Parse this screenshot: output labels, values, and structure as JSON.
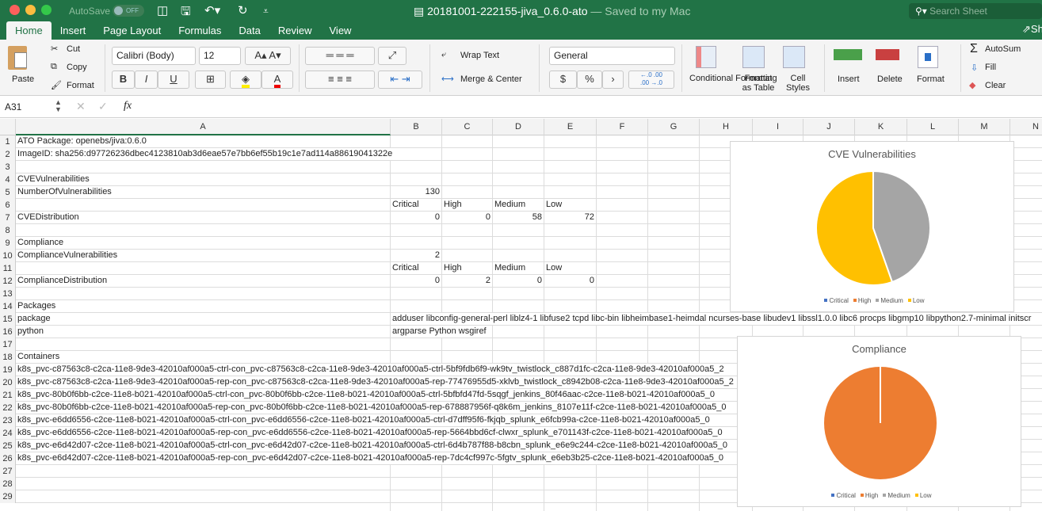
{
  "window": {
    "autosave": "AutoSave",
    "toggle": "OFF",
    "file_name": "20181001-222155-jiva_0.6.0-ato",
    "saved_status": " — Saved to my Mac",
    "search_placeholder": "Search Sheet",
    "share": "Sh"
  },
  "tabs": [
    {
      "label": "Home",
      "active": true
    },
    {
      "label": "Insert"
    },
    {
      "label": "Page Layout"
    },
    {
      "label": "Formulas"
    },
    {
      "label": "Data"
    },
    {
      "label": "Review"
    },
    {
      "label": "View"
    }
  ],
  "ribbon": {
    "paste": "Paste",
    "cut": "Cut",
    "copy": "Copy",
    "format_painter": "Format",
    "font_name": "Calibri (Body)",
    "font_size": "12",
    "bold": "B",
    "italic": "I",
    "underline": "U",
    "wrap_text": "Wrap Text",
    "merge_center": "Merge & Center",
    "number_format": "General",
    "currency": "$",
    "percent": "%",
    "comma": "›",
    "conditional_formatting": "Conditional Formatting",
    "format_as_table": "Format as Table",
    "cell_styles": "Cell Styles",
    "insert": "Insert",
    "delete": "Delete",
    "format": "Format",
    "autosum": "AutoSum",
    "fill": "Fill",
    "clear": "Clear"
  },
  "formula_bar": {
    "name_box": "A31",
    "fx": "fx",
    "content": ""
  },
  "columns": [
    "A",
    "B",
    "C",
    "D",
    "E",
    "F",
    "G",
    "H",
    "I",
    "J",
    "K",
    "L",
    "M",
    "N"
  ],
  "rows": [
    {
      "n": "1",
      "A": "ATO Package: openebs/jiva:0.6.0"
    },
    {
      "n": "2",
      "A": "ImageID: sha256:d97726236dbec4123810ab3d6eae57e7bb6ef55b19c1e7ad114a88619041322e"
    },
    {
      "n": "3"
    },
    {
      "n": "4",
      "A": "CVEVulnerabilities"
    },
    {
      "n": "5",
      "A": "NumberOfVulnerabilities",
      "B": "130"
    },
    {
      "n": "6",
      "B": "Critical",
      "C": "High",
      "D": "Medium",
      "E": "Low"
    },
    {
      "n": "7",
      "A": "CVEDistribution",
      "B": "0",
      "C": "0",
      "D": "58",
      "E": "72"
    },
    {
      "n": "8"
    },
    {
      "n": "9",
      "A": "Compliance"
    },
    {
      "n": "10",
      "A": "ComplianceVulnerabilities",
      "B": "2"
    },
    {
      "n": "11",
      "B": "Critical",
      "C": "High",
      "D": "Medium",
      "E": "Low"
    },
    {
      "n": "12",
      "A": "ComplianceDistribution",
      "B": "0",
      "C": "2",
      "D": "0",
      "E": "0"
    },
    {
      "n": "13"
    },
    {
      "n": "14",
      "A": "Packages"
    },
    {
      "n": "15",
      "A": "package",
      "B": "adduser libconfig-general-perl liblz4-1 libfuse2 tcpd libc-bin libheimbase1-heimdal ncurses-base libudev1 libssl1.0.0 libc6 procps libgmp10 libpython2.7-minimal initscr"
    },
    {
      "n": "16",
      "A": "python",
      "B": "argparse Python wsgiref"
    },
    {
      "n": "17"
    },
    {
      "n": "18",
      "A": "Containers"
    },
    {
      "n": "19",
      "A": "k8s_pvc-c87563c8-c2ca-11e8-9de3-42010af000a5-ctrl-con_pvc-c87563c8-c2ca-11e8-9de3-42010af000a5-ctrl-5bf9fdb6f9-wk9tv_twistlock_c887d1fc-c2ca-11e8-9de3-42010af000a5_2"
    },
    {
      "n": "20",
      "A": "k8s_pvc-c87563c8-c2ca-11e8-9de3-42010af000a5-rep-con_pvc-c87563c8-c2ca-11e8-9de3-42010af000a5-rep-77476955d5-xklvb_twistlock_c8942b08-c2ca-11e8-9de3-42010af000a5_2"
    },
    {
      "n": "21",
      "A": "k8s_pvc-80b0f6bb-c2ce-11e8-b021-42010af000a5-ctrl-con_pvc-80b0f6bb-c2ce-11e8-b021-42010af000a5-ctrl-5bfbfd47fd-5sqgf_jenkins_80f46aac-c2ce-11e8-b021-42010af000a5_0"
    },
    {
      "n": "22",
      "A": "k8s_pvc-80b0f6bb-c2ce-11e8-b021-42010af000a5-rep-con_pvc-80b0f6bb-c2ce-11e8-b021-42010af000a5-rep-678887956f-q8k6m_jenkins_8107e11f-c2ce-11e8-b021-42010af000a5_0"
    },
    {
      "n": "23",
      "A": "k8s_pvc-e6dd6556-c2ce-11e8-b021-42010af000a5-ctrl-con_pvc-e6dd6556-c2ce-11e8-b021-42010af000a5-ctrl-d7dff95f6-fkjqb_splunk_e6fcb99a-c2ce-11e8-b021-42010af000a5_0"
    },
    {
      "n": "24",
      "A": "k8s_pvc-e6dd6556-c2ce-11e8-b021-42010af000a5-rep-con_pvc-e6dd6556-c2ce-11e8-b021-42010af000a5-rep-5664bbd6cf-clwxr_splunk_e701143f-c2ce-11e8-b021-42010af000a5_0"
    },
    {
      "n": "25",
      "A": "k8s_pvc-e6d42d07-c2ce-11e8-b021-42010af000a5-ctrl-con_pvc-e6d42d07-c2ce-11e8-b021-42010af000a5-ctrl-6d4b787f88-b8cbn_splunk_e6e9c244-c2ce-11e8-b021-42010af000a5_0"
    },
    {
      "n": "26",
      "A": "k8s_pvc-e6d42d07-c2ce-11e8-b021-42010af000a5-rep-con_pvc-e6d42d07-c2ce-11e8-b021-42010af000a5-rep-7dc4cf997c-5fgtv_splunk_e6eb3b25-c2ce-11e8-b021-42010af000a5_0"
    },
    {
      "n": "27"
    },
    {
      "n": "28"
    },
    {
      "n": "29"
    }
  ],
  "chart_data": [
    {
      "type": "pie",
      "title": "CVE Vulnerabilities",
      "categories": [
        "Critical",
        "High",
        "Medium",
        "Low"
      ],
      "values": [
        0,
        0,
        58,
        72
      ],
      "colors": [
        "#4472c4",
        "#ed7d31",
        "#a5a5a5",
        "#ffc000"
      ],
      "legend": "bottom"
    },
    {
      "type": "pie",
      "title": "Compliance",
      "categories": [
        "Critical",
        "High",
        "Medium",
        "Low"
      ],
      "values": [
        0,
        2,
        0,
        0
      ],
      "colors": [
        "#4472c4",
        "#ed7d31",
        "#a5a5a5",
        "#ffc000"
      ],
      "legend": "bottom"
    }
  ]
}
